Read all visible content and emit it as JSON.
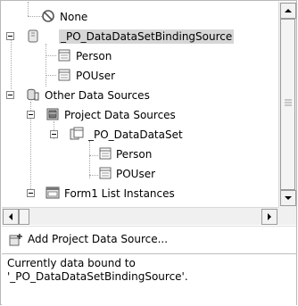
{
  "tree": {
    "items": [
      {
        "label": "None",
        "icon": "none-icon"
      },
      {
        "label": "_PO_DataDataSetBindingSource",
        "icon": "binding-source-icon",
        "selected": true
      },
      {
        "label": "Person",
        "icon": "table-icon"
      },
      {
        "label": "POUser",
        "icon": "table-icon"
      },
      {
        "label": "Other Data Sources",
        "icon": "data-sources-icon"
      },
      {
        "label": "Project Data Sources",
        "icon": "project-data-sources-icon"
      },
      {
        "label": "_PO_DataDataSet",
        "icon": "dataset-icon"
      },
      {
        "label": "Person",
        "icon": "table-icon"
      },
      {
        "label": "POUser",
        "icon": "table-icon"
      },
      {
        "label": "Form1 List Instances",
        "icon": "form-list-icon"
      }
    ]
  },
  "action": {
    "label": "Add Project Data Source...",
    "icon": "add-data-source-icon"
  },
  "status": {
    "line1": "Currently data bound to",
    "line2": "'_PO_DataDataSetBindingSource'."
  },
  "colors": {
    "selection": "#d6d6d6",
    "border": "#b9b9b9",
    "scrollbar": "#f0f0f0"
  }
}
